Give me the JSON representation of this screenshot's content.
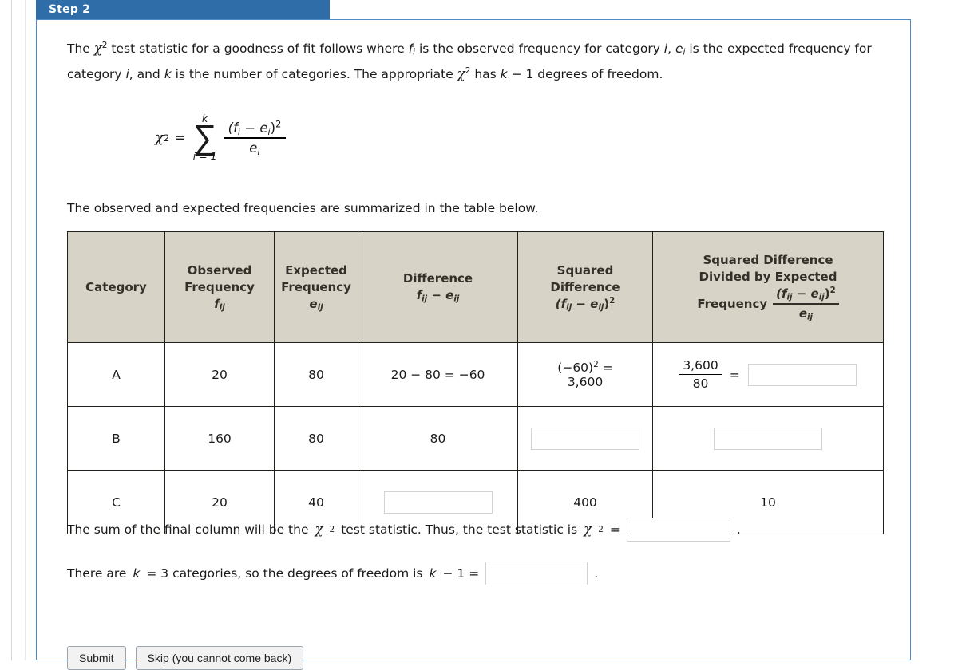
{
  "step": {
    "label": "Step 2"
  },
  "intro": {
    "part1": "The ",
    "chi": "χ",
    "exp2": "2",
    "part2": " test statistic for a goodness of fit follows where ",
    "f": "f",
    "sub_i": "i",
    "part3": " is the observed frequency for category ",
    "i1": "i",
    "part4": ", ",
    "e": "e",
    "part5": " is the expected frequency for category ",
    "i2": "i",
    "part6": ", and ",
    "k": "k",
    "part7": " is the number of categories. The appropriate ",
    "part8": " has ",
    "k2": "k",
    "part9": " − 1 degrees of freedom."
  },
  "formula": {
    "lhs": "χ",
    "lhs_exp": "2",
    "equals": "=",
    "sigma": "∑",
    "sigma_top": "k",
    "sigma_bottom": "i = 1",
    "numerator_open": "(",
    "numerator_f": "f",
    "numerator_fsub": "i",
    "numerator_minus": " − ",
    "numerator_e": "e",
    "numerator_esub": "i",
    "numerator_close": ")",
    "numerator_exp": "2",
    "denominator_e": "e",
    "denominator_sub": "i"
  },
  "table_intro": "The observed and expected frequencies are summarized in the table below.",
  "table": {
    "headers": [
      {
        "line1": "Category",
        "line2": "",
        "symbol": ""
      },
      {
        "line1": "Observed",
        "line2": "Frequency",
        "symbol": "f",
        "symbol_sub": "ij"
      },
      {
        "line1": "Expected",
        "line2": "Frequency",
        "symbol": "e",
        "symbol_sub": "ij"
      },
      {
        "line1": "Difference",
        "line2": "",
        "symbol": "f",
        "symbol_sub": "ij",
        "symbol2": "e",
        "symbol2_sub": "ij",
        "op": " − "
      },
      {
        "line1": "Squared",
        "line2": "Difference",
        "symbol_expr": "(f",
        "symbol_sub": "ij",
        "op": " − ",
        "symbol2": "e",
        "symbol2_sub": "ij",
        "close": ")",
        "exp": "2"
      },
      {
        "line1": "Squared Difference",
        "line2": "Divided by Expected",
        "line3": "Frequency",
        "frac_num_open": "(f",
        "frac_num_sub1": "ij",
        "frac_num_op": " − ",
        "frac_num_e": "e",
        "frac_num_sub2": "ij",
        "frac_num_close": ")",
        "frac_num_exp": "2",
        "frac_den": "e",
        "frac_den_sub": "ij"
      }
    ],
    "rows": [
      {
        "category": "A",
        "observed": "20",
        "expected": "80",
        "difference": "20 − 80 = −60",
        "squared_line1": "(−60)",
        "squared_exp": "2",
        "squared_eq": " =",
        "squared_line2": "3,600",
        "last_num": "3,600",
        "last_den": "80",
        "last_eq": "=",
        "last_input": ""
      },
      {
        "category": "B",
        "observed": "160",
        "expected": "80",
        "difference": "80",
        "squared_input": "",
        "last_input": ""
      },
      {
        "category": "C",
        "observed": "20",
        "expected": "40",
        "difference_input": "",
        "squared": "400",
        "last": "10"
      }
    ]
  },
  "sum_sentence": {
    "part1": "The sum of the final column will be the ",
    "chi": "χ",
    "exp": "2",
    "part2": " test statistic. Thus, the test statistic is ",
    "part3": " = ",
    "input": "",
    "period": "."
  },
  "df_sentence": {
    "part1": "There are ",
    "k": "k",
    "part2": " = 3 categories, so the degrees of freedom is ",
    "k2": "k",
    "part3": " − 1 = ",
    "input": "",
    "period": "."
  },
  "footer": {
    "submit": "Submit",
    "skip": "Skip (you cannot come back)"
  },
  "colors": {
    "banner": "#2f6da8",
    "panel_border": "#4f8cc4",
    "table_header_bg": "#d7d3c6",
    "table_border": "#231f1b",
    "input_border": "#d2d2d2"
  }
}
